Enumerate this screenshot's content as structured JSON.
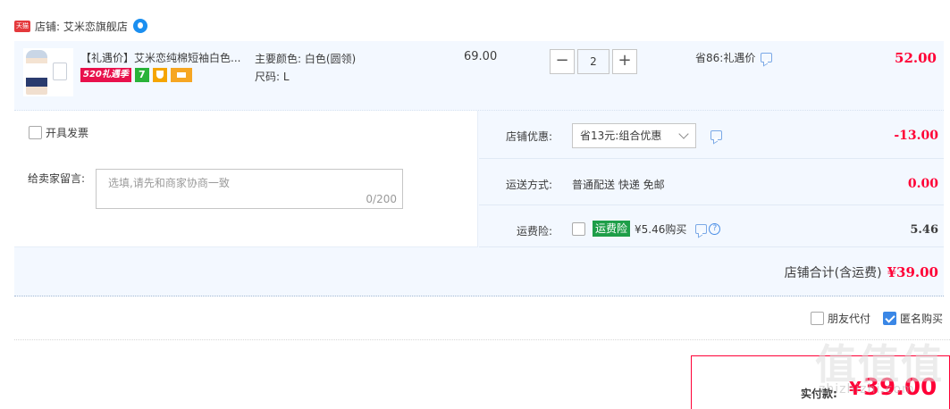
{
  "shop": {
    "tmall_badge": "天猫",
    "name": "店铺: 艾米恋旗舰店",
    "chat_icon": "wangwang-chat-icon"
  },
  "item": {
    "title": "【礼遇价】艾米恋纯棉短袖白色...",
    "badge_520": "520礼遇季",
    "badge_7": "7",
    "sku_color": "主要颜色: 白色(圆领)",
    "sku_size": "尺码: L",
    "price": "69.00",
    "qty_minus": "−",
    "quantity": "2",
    "qty_plus": "+",
    "saving": "省86:礼遇价",
    "subtotal": "52.00"
  },
  "order": {
    "invoice_label": "开具发票",
    "memo_label": "给卖家留言:",
    "memo_placeholder": "选填,请先和商家协商一致",
    "memo_count": "0/200",
    "promo_label": "店铺优惠:",
    "promo_value": "省13元:组合优惠",
    "promo_amount": "-13.00",
    "shipping_label": "运送方式:",
    "shipping_value": "普通配送 快递 免邮",
    "shipping_amount": "0.00",
    "insurance_label": "运费险:",
    "insurance_tag": "运费险",
    "insurance_price": "¥5.46购买",
    "insurance_amount": "5.46",
    "shop_total_label": "店铺合计(含运费)",
    "shop_total_amount": "¥39.00"
  },
  "options": {
    "friend_pay": "朋友代付",
    "anonymous": "匿名购买",
    "anonymous_checked": true
  },
  "payment": {
    "label": "实付款:",
    "yen": "¥",
    "amount": "39.00"
  },
  "watermark": {
    "text": "值值值",
    "sub": "zhizhizhi.com"
  },
  "colors": {
    "accent_red": "#ff0036",
    "panel_blue": "#f3f8ff",
    "checkbox_blue": "#3a87e6",
    "insurance_green": "#1e9e48"
  }
}
